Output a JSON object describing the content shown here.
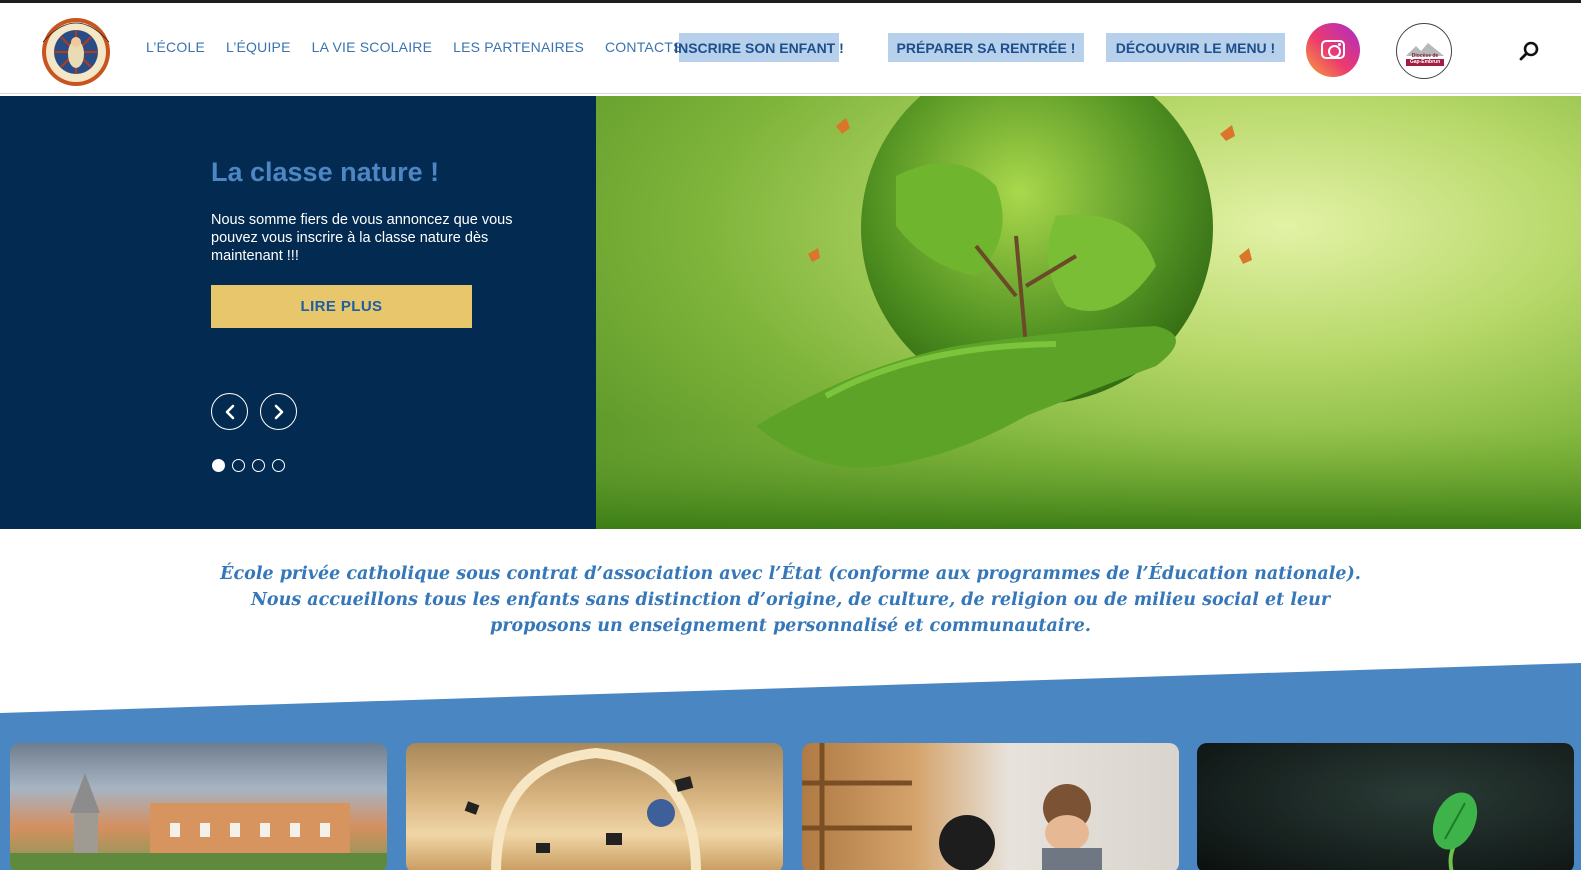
{
  "header": {
    "logo_alt": "ECOLE DU SAINT COEUR DE MARIE",
    "nav": [
      "L’ÉCOLE",
      "L’ÉQUIPE",
      "LA VIE SCOLAIRE",
      "LES PARTENAIRES",
      "CONTACTS"
    ],
    "cta": [
      "INSCRIRE SON ENFANT !",
      "PRÉPARER SA RENTRÉE !",
      "DÉCOUVRIR LE MENU !"
    ],
    "icons": {
      "instagram": "instagram-icon",
      "diocese": "diocese-logo",
      "search": "search-icon"
    },
    "diocese_line1": "Diocèse de",
    "diocese_line2": "Gap-Embrun"
  },
  "hero": {
    "title": "La classe nature !",
    "text": "Nous somme fiers de vous annoncez que vous pouvez vous inscrire à la classe nature dès maintenant !!!",
    "button": "LIRE PLUS",
    "slides": 4,
    "active_slide": 1
  },
  "intro": {
    "line1": "École privée catholique sous contrat d’association avec l’État (conforme aux programmes de l’Éducation nationale).",
    "line2": "Nous accueillons tous les enfants sans distinction d’origine, de culture, de religion ou de milieu social et leur",
    "line3": "proposons un enseignement personnalisé et communautaire."
  },
  "cards": [
    "school-building-photo",
    "chapel-graduation-photo",
    "classroom-children-photo",
    "seedling-photo"
  ],
  "colors": {
    "accent_blue": "#3b73b1",
    "hero_navy": "#032b52",
    "button_gold": "#e8c76c",
    "band_blue": "#4a86c1",
    "cta_bg": "#b7d0eb"
  }
}
